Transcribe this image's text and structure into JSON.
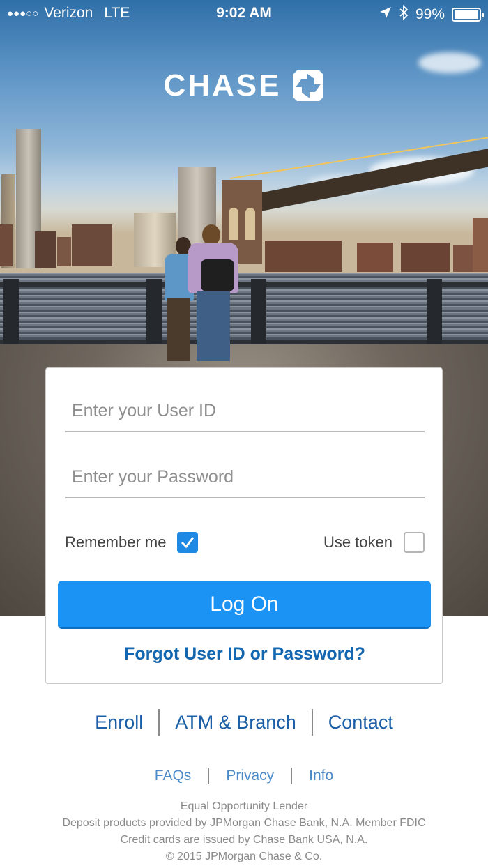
{
  "status_bar": {
    "signal_dots": "●●●○○",
    "carrier": "Verizon",
    "network": "LTE",
    "time": "9:02 AM",
    "battery_percent": "99%",
    "battery_level": 0.99,
    "icons": [
      "location-arrow-icon",
      "bluetooth-icon",
      "battery-icon"
    ]
  },
  "brand": {
    "name": "CHASE",
    "logo_icon": "chase-octagon-logo-icon",
    "color": "#ffffff"
  },
  "login": {
    "user_id_placeholder": "Enter your User ID",
    "user_id_value": "",
    "password_placeholder": "Enter your Password",
    "password_value": "",
    "remember_me_label": "Remember me",
    "remember_me_checked": true,
    "use_token_label": "Use token",
    "use_token_checked": false,
    "log_on_label": "Log On",
    "forgot_label": "Forgot User ID or Password?"
  },
  "footer": {
    "main_links": [
      "Enroll",
      "ATM & Branch",
      "Contact"
    ],
    "sub_links": [
      "FAQs",
      "Privacy",
      "Info"
    ],
    "legal": [
      "Equal Opportunity Lender",
      "Deposit products provided by JPMorgan Chase Bank, N.A. Member FDIC",
      "Credit cards are issued by Chase Bank USA, N.A.",
      "© 2015 JPMorgan Chase & Co."
    ]
  },
  "colors": {
    "accent": "#1a93f5",
    "link": "#1366b0",
    "checkbox_checked": "#1e88e5"
  }
}
